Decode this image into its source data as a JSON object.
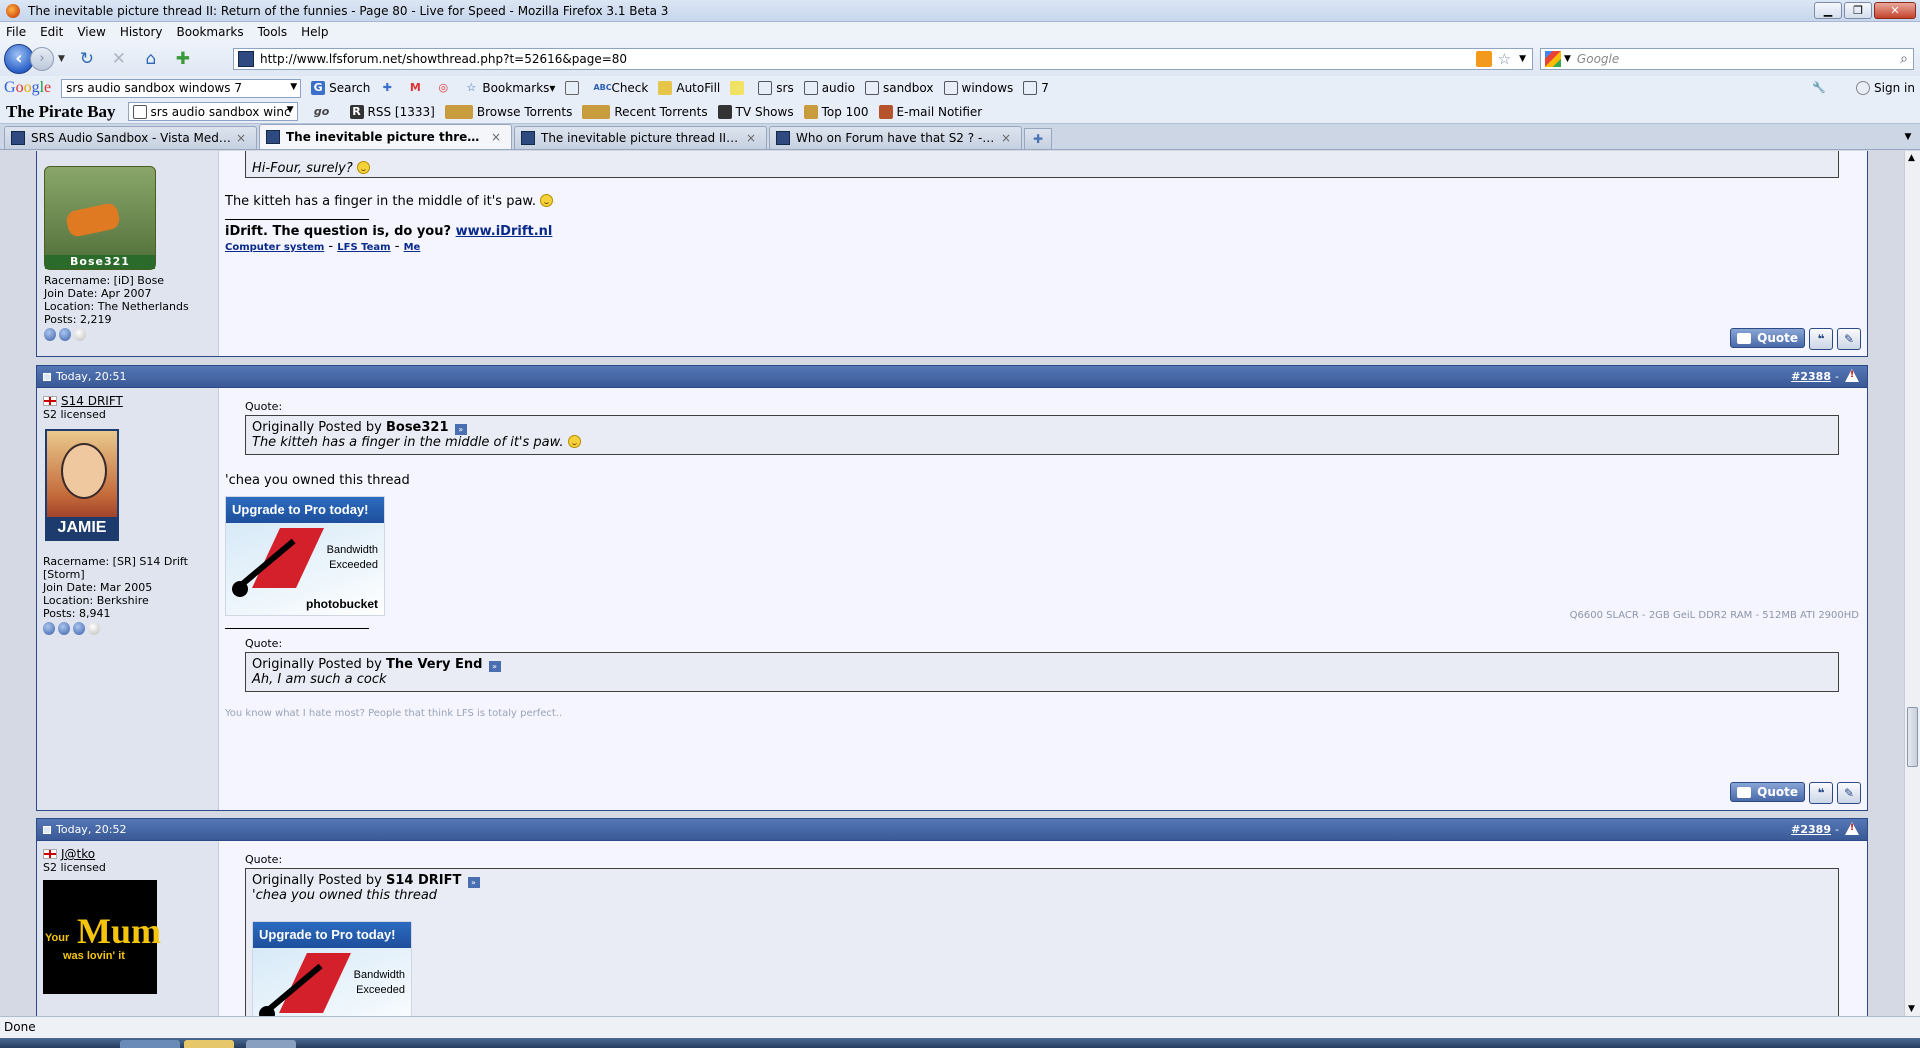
{
  "window": {
    "title": "The inevitable picture thread II: Return of the funnies - Page 80 - Live for Speed - Mozilla Firefox 3.1 Beta 3",
    "min": "▁",
    "max": "❐",
    "close": "✕"
  },
  "menu": [
    "File",
    "Edit",
    "View",
    "History",
    "Bookmarks",
    "Tools",
    "Help"
  ],
  "nav": {
    "url": "http://www.lfsforum.net/showthread.php?t=52616&page=80",
    "search_placeholder": "Google"
  },
  "google_toolbar": {
    "logo": [
      "G",
      "o",
      "o",
      "g",
      "l",
      "e"
    ],
    "query": "srs audio sandbox windows 7",
    "search": "Search",
    "bookmarks": "Bookmarks▾",
    "check": "Check",
    "autofill": "AutoFill",
    "terms": [
      "srs",
      "audio",
      "sandbox",
      "windows",
      "7"
    ],
    "signin": "Sign in"
  },
  "tpb_toolbar": {
    "logo": "The Pirate Bay",
    "query": "srs audio sandbox winc",
    "rss": "RSS [1333]",
    "browse": "Browse Torrents",
    "recent": "Recent Torrents",
    "tv": "TV Shows",
    "top100": "Top 100",
    "email": "E-mail Notifier"
  },
  "tabs": [
    {
      "label": "SRS Audio Sandbox - Vista Media C...",
      "active": false
    },
    {
      "label": "The inevitable picture thread II: R...",
      "active": true
    },
    {
      "label": "The inevitable picture thread II: Ret...",
      "active": false
    },
    {
      "label": "Who on Forum have that S2 ? - Live...",
      "active": false
    }
  ],
  "posts": {
    "p0": {
      "quote_text": "Hi-Four, surely?",
      "message": "The kitteh has a finger in the middle of it's paw.",
      "sig_line": "iDrift. The question is, do you?",
      "sig_link": "www.iDrift.nl",
      "sig_links": [
        "Computer system",
        "LFS Team",
        "Me"
      ],
      "avatar_name": "Bose321",
      "racename": "Racername: [iD] Bose",
      "join": "Join Date: Apr 2007",
      "location": "Location: The Netherlands",
      "posts": "Posts: 2,219",
      "quote_btn": "Quote"
    },
    "p1": {
      "date": "Today, 20:51",
      "num": "#2388",
      "username": "S14 DRIFT",
      "status": "S2 licensed",
      "avatar_text": "JAMIE",
      "racename": "Racername: [SR] S14 Drift [Storm]",
      "join": "Join Date: Mar 2005",
      "location": "Location: Berkshire",
      "posts": "Posts: 8,941",
      "quote_label": "Quote:",
      "quote_by_prefix": "Originally Posted by",
      "quote_by": "Bose321",
      "quote_text": "The kitteh has a finger in the middle of it's paw.",
      "message": "'chea you owned this thread",
      "upgrade_title": "Upgrade to Pro today!",
      "bandwidth": "Bandwidth",
      "exceeded": "Exceeded",
      "photobucket": "photobucket",
      "sig_right": "Q6600 SLACR - 2GB GeiL DDR2 RAM - 512MB ATI 2900HD",
      "sig_quote_label": "Quote:",
      "sig_quote_prefix": "Originally Posted by",
      "sig_quote_by": "The Very End",
      "sig_quote_text": "Ah, I am such a cock",
      "sig_grey": "You know what I hate most? People that think LFS is totaly perfect..",
      "quote_btn": "Quote"
    },
    "p2": {
      "date": "Today, 20:52",
      "num": "#2389",
      "username": "J@tko",
      "status": "S2 licensed",
      "avatar_line1": "Your",
      "avatar_logo": "Mum",
      "avatar_line2": "was lovin' it",
      "quote_label": "Quote:",
      "quote_by_prefix": "Originally Posted by",
      "quote_by": "S14 DRIFT",
      "quote_text": "'chea you owned this thread",
      "upgrade_title": "Upgrade to Pro today!",
      "bandwidth": "Bandwidth",
      "exceeded": "Exceeded"
    }
  },
  "status": "Done"
}
